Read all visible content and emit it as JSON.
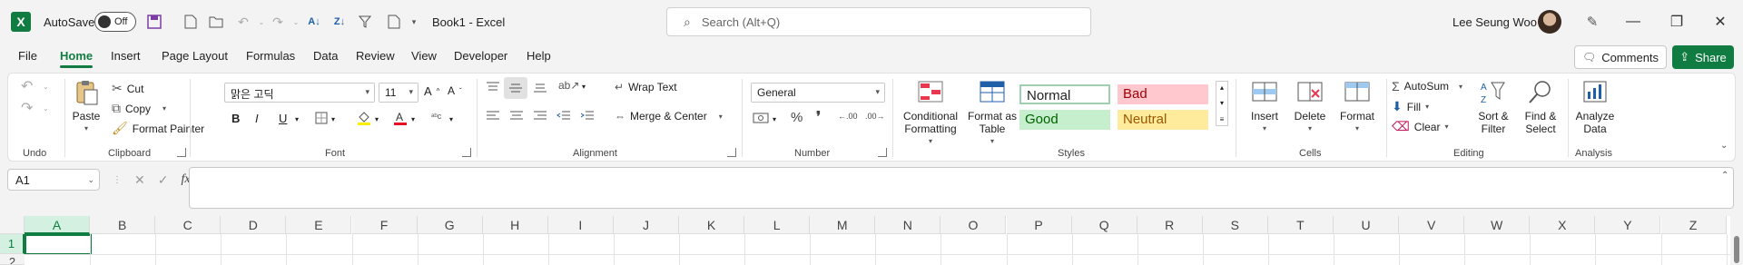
{
  "titlebar": {
    "app_icon": "excel-logo-icon",
    "autosave_label": "AutoSave",
    "autosave_state": "Off",
    "doc_title": "Book1  -  Excel",
    "search_placeholder": "Search (Alt+Q)",
    "user_name": "Lee Seung Woo"
  },
  "menu": {
    "tabs": [
      "File",
      "Home",
      "Insert",
      "Page Layout",
      "Formulas",
      "Data",
      "Review",
      "View",
      "Developer",
      "Help"
    ],
    "active_tab": "Home",
    "comments_label": "Comments",
    "share_label": "Share"
  },
  "ribbon": {
    "undo_group": "Undo",
    "clipboard": {
      "label": "Clipboard",
      "paste": "Paste",
      "cut": "Cut",
      "copy": "Copy",
      "format_painter": "Format Painter"
    },
    "font": {
      "label": "Font",
      "font_name": "맑은 고딕",
      "font_size": "11",
      "bold": "B",
      "italic": "I",
      "underline": "U"
    },
    "alignment": {
      "label": "Alignment",
      "wrap_text": "Wrap Text",
      "merge_center": "Merge & Center"
    },
    "number": {
      "label": "Number",
      "format": "General"
    },
    "styles": {
      "label": "Styles",
      "conditional_formatting": "Conditional Formatting",
      "format_as_table": "Format as Table",
      "normal": "Normal",
      "bad": "Bad",
      "good": "Good",
      "neutral": "Neutral"
    },
    "cells": {
      "label": "Cells",
      "insert": "Insert",
      "delete": "Delete",
      "format": "Format"
    },
    "editing": {
      "label": "Editing",
      "autosum": "AutoSum",
      "fill": "Fill",
      "clear": "Clear",
      "sort_filter": "Sort & Filter",
      "find_select": "Find & Select"
    },
    "analysis": {
      "label": "Analysis",
      "analyze_data": "Analyze Data"
    }
  },
  "formula_bar": {
    "name_box": "A1",
    "fx": "fx"
  },
  "grid": {
    "columns": [
      "A",
      "B",
      "C",
      "D",
      "E",
      "F",
      "G",
      "H",
      "I",
      "J",
      "K",
      "L",
      "M",
      "N",
      "O",
      "P",
      "Q",
      "R",
      "S",
      "T",
      "U",
      "V",
      "W",
      "X",
      "Y",
      "Z"
    ],
    "rows": [
      "1",
      "2"
    ],
    "active_cell": "A1"
  },
  "colors": {
    "accent": "#107c41",
    "bad_bg": "#ffc7ce",
    "good_bg": "#c6efce",
    "neutral_bg": "#ffeb9c"
  }
}
